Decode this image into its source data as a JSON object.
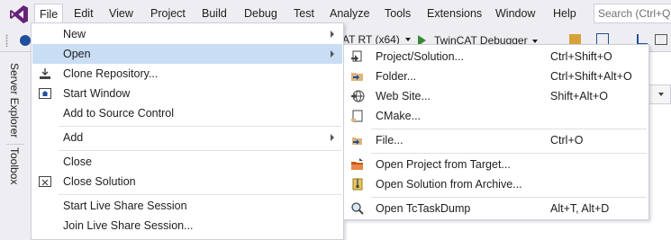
{
  "menubar": {
    "items": [
      "File",
      "Edit",
      "View",
      "Project",
      "Build",
      "Debug",
      "Test",
      "Analyze",
      "Tools",
      "Extensions",
      "Window",
      "Help"
    ],
    "search_placeholder": "Search (Ctrl+Q)"
  },
  "toolbar": {
    "platform": "AT RT (x64)",
    "debugger": "TwinCAT Debugger"
  },
  "side_tabs": {
    "server_explorer": "Server Explorer",
    "toolbox": "Toolbox"
  },
  "file_menu": {
    "items": [
      {
        "label": "New",
        "submenu": true,
        "icon": "none"
      },
      {
        "label": "Open",
        "submenu": true,
        "icon": "none"
      },
      {
        "label": "Clone Repository...",
        "icon": "clone-repo-icon"
      },
      {
        "label": "Start Window",
        "icon": "start-window-icon"
      },
      {
        "label": "Add to Source Control",
        "icon": "none"
      },
      {
        "label": "Add",
        "submenu": true,
        "icon": "none"
      },
      {
        "label": "Close",
        "icon": "none"
      },
      {
        "label": "Close Solution",
        "icon": "close-solution-icon"
      },
      {
        "label": "Start Live Share Session",
        "icon": "none"
      },
      {
        "label": "Join Live Share Session...",
        "icon": "none"
      }
    ]
  },
  "open_submenu": {
    "items": [
      {
        "label": "Project/Solution...",
        "shortcut": "Ctrl+Shift+O",
        "icon": "project-solution-icon"
      },
      {
        "label": "Folder...",
        "shortcut": "Ctrl+Shift+Alt+O",
        "icon": "folder-icon"
      },
      {
        "label": "Web Site...",
        "shortcut": "Shift+Alt+O",
        "icon": "web-site-icon"
      },
      {
        "label": "CMake...",
        "shortcut": "",
        "icon": "cmake-icon"
      },
      {
        "label": "File...",
        "shortcut": "Ctrl+O",
        "icon": "file-open-icon"
      },
      {
        "label": "Open Project from Target...",
        "shortcut": "",
        "icon": "open-from-target-icon"
      },
      {
        "label": "Open Solution from Archive...",
        "shortcut": "",
        "icon": "solution-archive-icon"
      },
      {
        "label": "Open TcTaskDump",
        "shortcut": "Alt+T, Alt+D",
        "icon": "search-icon"
      }
    ]
  },
  "colors": {
    "accent_purple": "#68217a",
    "highlight": "#c9def5",
    "folder_yellow": "#dcb67a"
  }
}
